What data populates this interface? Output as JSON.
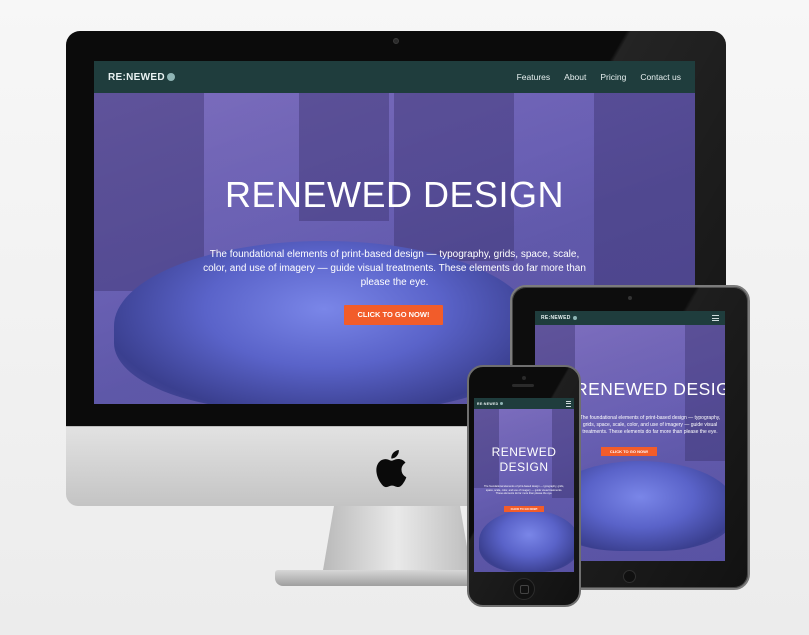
{
  "brand": {
    "logo": "RE:NEWED",
    "nav_color": "#1f3d3d",
    "accent": "#f25c2a",
    "overlay": "#7866c8"
  },
  "nav": {
    "links": [
      "Features",
      "About",
      "Pricing",
      "Contact us"
    ]
  },
  "hero": {
    "title": "RENEWED DESIGN",
    "description": "The foundational elements of print-based design — typography, grids, space, scale, color, and use of imagery — guide visual treatments. These elements do far more than please the eye.",
    "cta_label": "CLICK TO GO NOW!"
  },
  "devices": {
    "imac_icon": "apple-logo-icon",
    "mobile_menu_icon": "hamburger-menu-icon"
  }
}
